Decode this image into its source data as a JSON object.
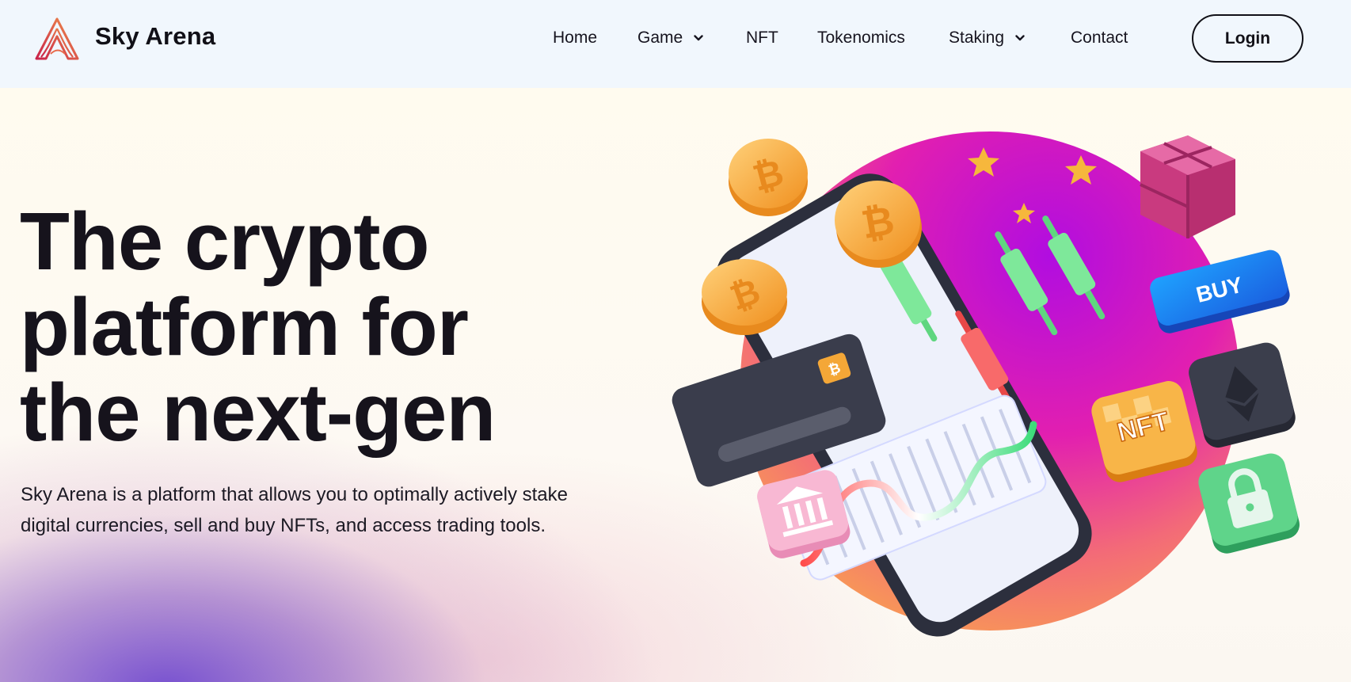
{
  "header": {
    "brand": "Sky Arena",
    "nav": [
      {
        "label": "Home",
        "dropdown": false
      },
      {
        "label": "Game",
        "dropdown": true
      },
      {
        "label": "NFT",
        "dropdown": false
      },
      {
        "label": "Tokenomics",
        "dropdown": false
      },
      {
        "label": "Staking",
        "dropdown": true
      },
      {
        "label": "Contact",
        "dropdown": false
      }
    ],
    "login_label": "Login"
  },
  "hero": {
    "headline_lines": [
      "The crypto",
      "platform for",
      "the next-gen"
    ],
    "subtext_lines": [
      "Sky Arena is a platform that allows you to optimally actively stake",
      "digital currencies, sell and buy NFTs, and access trading tools."
    ]
  },
  "illustration": {
    "buy_label": "BUY",
    "nft_label": "NFT",
    "icons": [
      "bitcoin-coin-icon",
      "ethereum-icon",
      "lock-icon",
      "bank-icon",
      "star-icon",
      "cube-icon",
      "credit-card-icon",
      "candlestick-chart-icon",
      "line-chart-icon",
      "smartphone-icon"
    ]
  },
  "colors": {
    "header_bg": "#f1f7fd",
    "text": "#16141f",
    "accent_magenta": "#d21ec8",
    "accent_orange": "#f59a35",
    "accent_purple": "#7048ce"
  }
}
